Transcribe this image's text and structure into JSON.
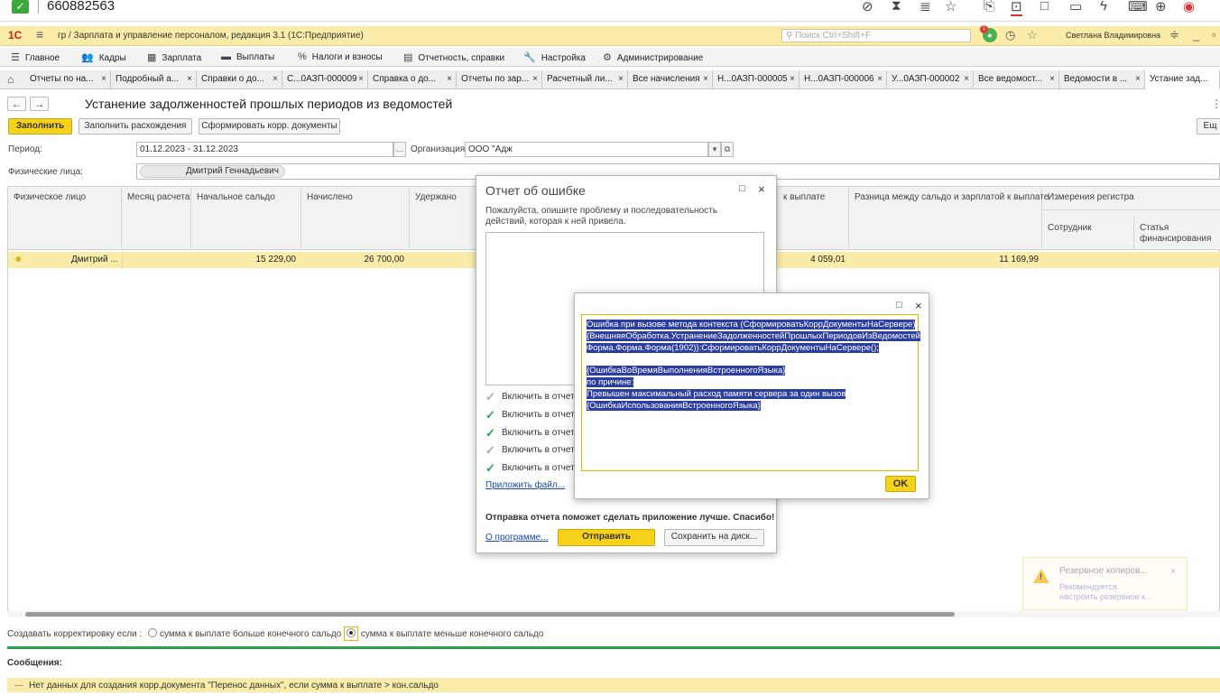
{
  "taskbar": {
    "number": "660882563",
    "check_icon": "✓"
  },
  "app": {
    "logo": "1С",
    "title": "гр / Зарплата и управление персоналом, редакция 3.1  (1С:Предприятие)",
    "search_placeholder": "Поиск Ctrl+Shift+F",
    "notifications_count": "1",
    "user": "Светлана Владимировна"
  },
  "menu": {
    "items": [
      "Главное",
      "Кадры",
      "Зарплата",
      "Выплаты",
      "Налоги и взносы",
      "Отчетность, справки",
      "Настройка",
      "Администрирование"
    ]
  },
  "tabs": [
    "Отчеты по на...",
    "Подробный а...",
    "Справки о до...",
    "С...0АЗП-000009",
    "Справка о до...",
    "Отчеты по зар...",
    "Расчетный ли...",
    "Все начисления",
    "Н...0АЗП-000005",
    "Н...0АЗП-000006",
    "У...0АЗП-000002",
    "Все ведомост...",
    "Ведомости в ...",
    "Устание зад..."
  ],
  "page": {
    "title": "Устанение задолженностей прошлых периодов из ведомостей",
    "btn_fill": "Заполнить",
    "btn_fill_diff": "Заполнить расхождения",
    "btn_form_docs": "Сформировать корр. документы",
    "btn_more": "Ещ",
    "period_label": "Период:",
    "period_value": "01.12.2023 - 31.12.2023",
    "org_label": "Организация:",
    "org_value": "ООО \"Адж",
    "persons_label": "Физические лица:",
    "persons_value": "Дмитрий Геннадьевич"
  },
  "grid": {
    "headers": [
      "Физическое лицо",
      "Месяц расчета",
      "Начальное сальдо",
      "Начислено",
      "Удержано",
      "к выплате",
      "Разница между сальдо и зарплатой к выплате",
      "Измерения регистра"
    ],
    "subheaders": [
      "Сотрудник",
      "Статья\nфинансирования"
    ],
    "rows": [
      {
        "person": "Дмитрий ...",
        "month": "",
        "start_balance": "15 229,00",
        "accrued": "26 700,00",
        "withheld": "",
        "to_pay": "4 059,01",
        "diff": "11 169,99"
      }
    ]
  },
  "correction": {
    "label": "Создавать корректировку если :",
    "option1": "сумма к выплате больше конечного сальдо",
    "option2": "сумма к выплате меньше конечного сальдо",
    "selected": 2
  },
  "messages": {
    "title": "Сообщения:",
    "items": [
      "Нет данных для создания корр.документа \"Перенос данных\", если сумма к выплате > кон.сальдо"
    ]
  },
  "error_report": {
    "title": "Отчет об ошибке",
    "description": "Пожалуйста, опишите проблему и последовательность действий, которая к ней привела.",
    "checkboxes": [
      {
        "label": "Включить в отчет г",
        "checked": true,
        "disabled": true
      },
      {
        "label": "Включить в отчет г",
        "checked": true,
        "disabled": false
      },
      {
        "label": "Включить в отчет г",
        "checked": true,
        "disabled": false
      },
      {
        "label": "Включить в отчет г",
        "checked": true,
        "disabled": true
      },
      {
        "label": "Включить в отчет г",
        "checked": true,
        "disabled": false
      }
    ],
    "attach_link": "Приложить файл...",
    "thanks": "Отправка отчета поможет сделать приложение лучше. Спасибо!",
    "about_link": "О программе...",
    "send_button": "Отправить",
    "save_button": "Сохранить на диск..."
  },
  "error_detail": {
    "lines": [
      "Ошибка при вызове метода контекста (СформироватьКоррДокументыНаСервере)",
      "{ВнешняяОбработка.УстранениеЗадолженностейПрошлыхПериодовИзВедомостей",
      "Форма.Форма.Форма(1902)}:СформироватьКоррДокументыНаСервере();",
      "",
      "{ОшибкаВоВремяВыполненияВстроенногоЯзыка}",
      "по причине:",
      "Превышен максимальный расход памяти сервера за один вызов",
      "{ОшибкаИспользованияВстроенногоЯзыка}"
    ],
    "ok_button": "OK"
  },
  "toast": {
    "title": "Резервное копиров...",
    "text_line1": "Рекомендуется",
    "text_line2": "настроить резервное к...",
    "icon": "!"
  }
}
